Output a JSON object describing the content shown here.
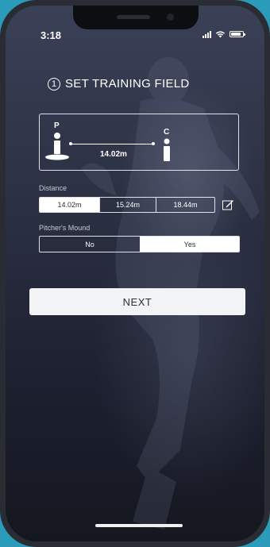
{
  "status_bar": {
    "time": "3:18"
  },
  "header": {
    "step_number": "1",
    "title": "SET TRAINING FIELD"
  },
  "field_diagram": {
    "pitcher_label": "P",
    "catcher_label": "C",
    "distance_label": "14.02m"
  },
  "distance": {
    "label": "Distance",
    "options": [
      "14.02m",
      "15.24m",
      "18.44m"
    ],
    "selected": "14.02m"
  },
  "mound": {
    "label": "Pitcher's Mound",
    "options": [
      "No",
      "Yes"
    ],
    "selected": "Yes"
  },
  "next_button": {
    "label": "NEXT"
  },
  "colors": {
    "accent": "#ffffff",
    "background_dark": "#1c2030",
    "button_text": "#2b2f3c"
  },
  "icons": [
    "step-number-icon",
    "pitcher-icon",
    "catcher-icon",
    "edit-icon",
    "signal-icon",
    "wifi-icon",
    "battery-icon"
  ]
}
